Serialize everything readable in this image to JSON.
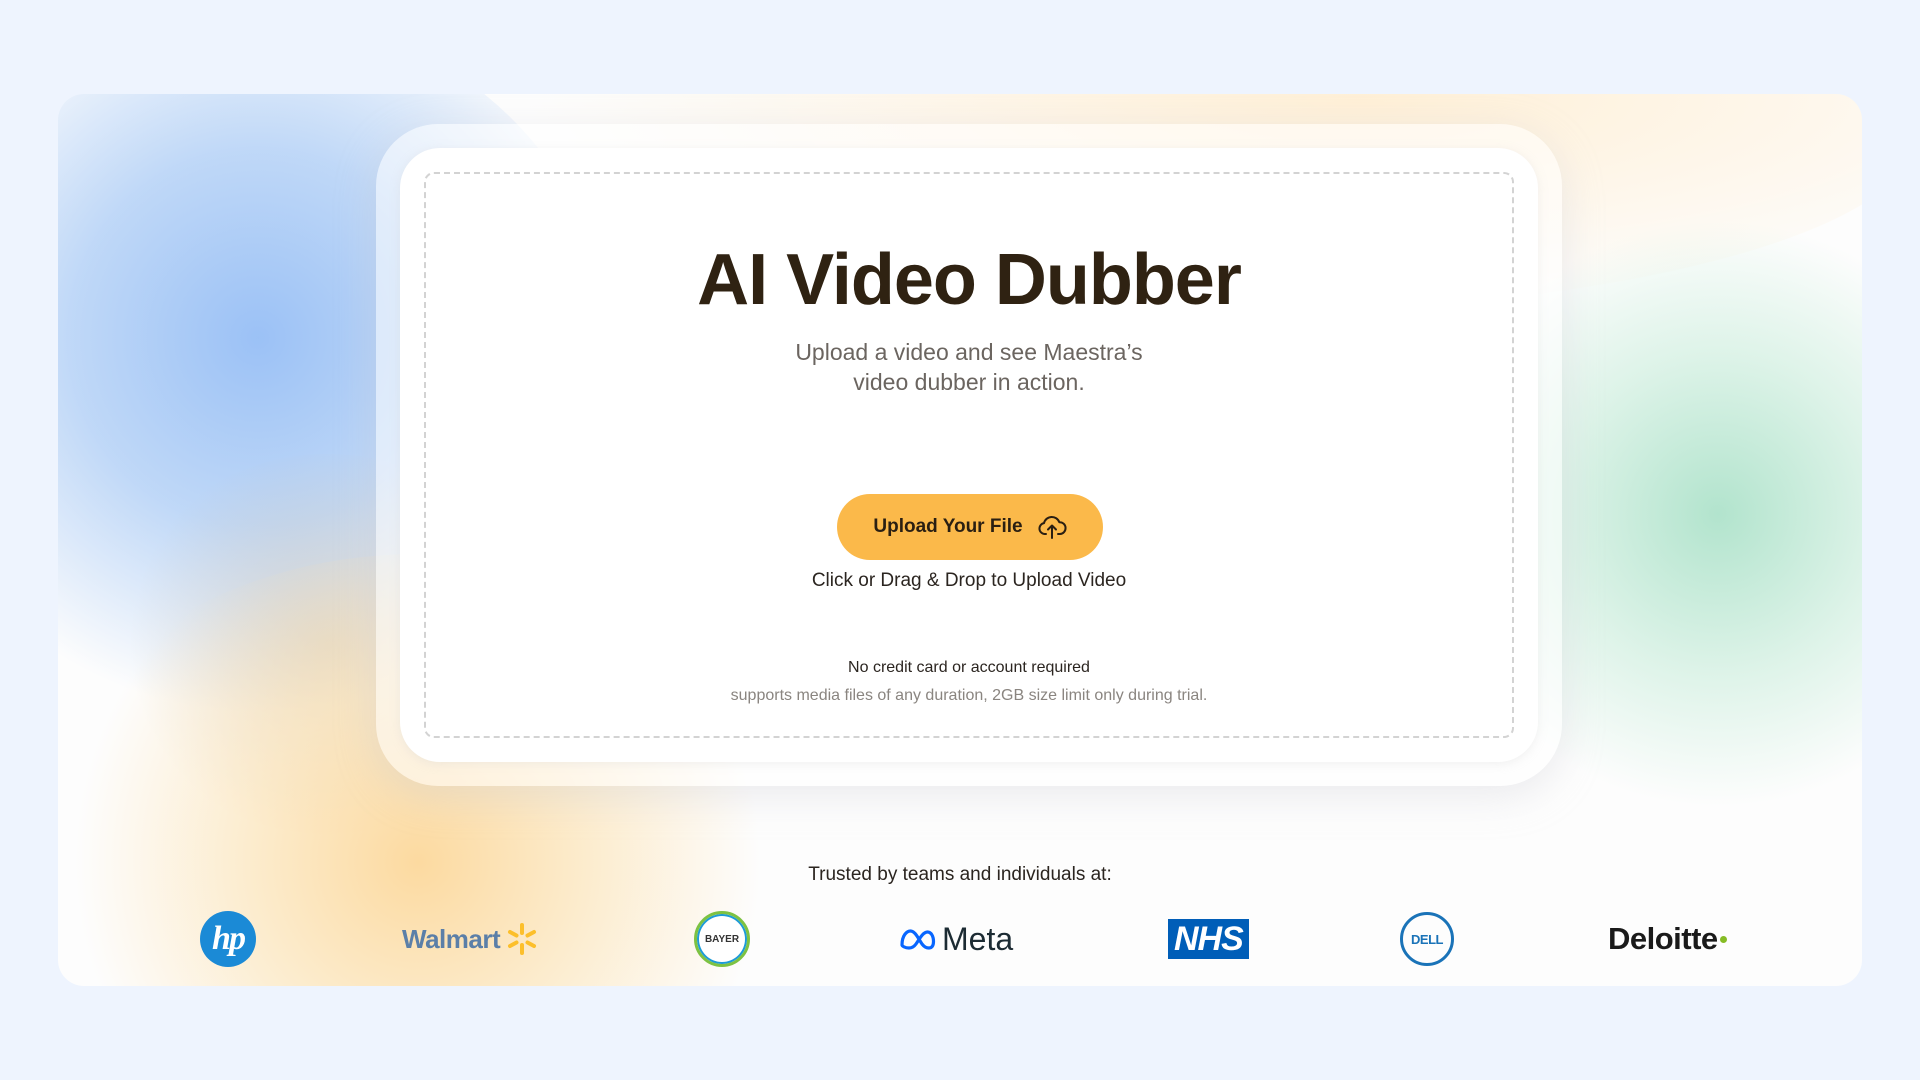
{
  "hero": {
    "title": "AI Video Dubber",
    "subtitle_line1": "Upload a video and see Maestra’s",
    "subtitle_line2": "video dubber in action."
  },
  "upload": {
    "button_label": "Upload Your File",
    "button_icon": "cloud-upload-icon",
    "hint": "Click or Drag & Drop to Upload Video",
    "no_credit_card": "No credit card or account required",
    "supports": "supports media files of any duration, 2GB size limit only during trial."
  },
  "trusted": {
    "heading": "Trusted by teams and individuals at:",
    "logos": [
      {
        "name": "hp",
        "text": "hp"
      },
      {
        "name": "walmart",
        "text": "Walmart"
      },
      {
        "name": "bayer",
        "text": "BAYER"
      },
      {
        "name": "meta",
        "text": "Meta"
      },
      {
        "name": "nhs",
        "text": "NHS"
      },
      {
        "name": "dell",
        "text": "DELL"
      },
      {
        "name": "deloitte",
        "text": "Deloitte"
      }
    ]
  },
  "colors": {
    "page_bg": "#eef4fe",
    "title": "#2f2212",
    "button": "#fbb94a",
    "walmart_spark": "#fcbf2b",
    "meta_blue": "#0866ff",
    "nhs_blue": "#005eb8",
    "dell_blue": "#1a73b8",
    "deloitte_green": "#86bc25"
  }
}
